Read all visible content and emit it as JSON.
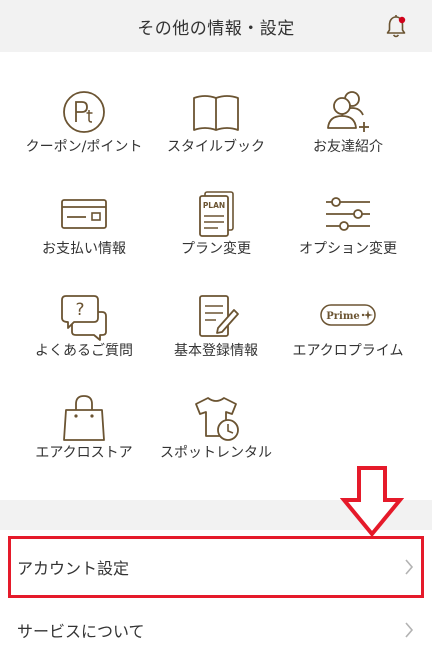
{
  "header": {
    "title": "その他の情報・設定",
    "icon": "bell-icon",
    "badge_color": "#d0021b"
  },
  "menu": [
    {
      "label": "クーポン/ポイント",
      "icon": "points-icon"
    },
    {
      "label": "スタイルブック",
      "icon": "book-icon"
    },
    {
      "label": "お友達紹介",
      "icon": "add-friend-icon"
    },
    {
      "label": "お支払い情報",
      "icon": "credit-card-icon"
    },
    {
      "label": "プラン変更",
      "icon": "plan-document-icon"
    },
    {
      "label": "オプション変更",
      "icon": "sliders-icon"
    },
    {
      "label": "よくあるご質問",
      "icon": "faq-bubble-icon"
    },
    {
      "label": "基本登録情報",
      "icon": "edit-document-icon"
    },
    {
      "label": "エアクロプライム",
      "icon": "prime-icon",
      "badge": "Prime"
    },
    {
      "label": "エアクロストア",
      "icon": "shopping-bag-icon"
    },
    {
      "label": "スポットレンタル",
      "icon": "shirt-clock-icon"
    }
  ],
  "settings": [
    {
      "label": "アカウント設定"
    },
    {
      "label": "サービスについて"
    }
  ],
  "colors": {
    "icon": "#6b5432",
    "highlight": "#e51a2a",
    "text": "#333333",
    "background_gray": "#f2f2f2"
  }
}
